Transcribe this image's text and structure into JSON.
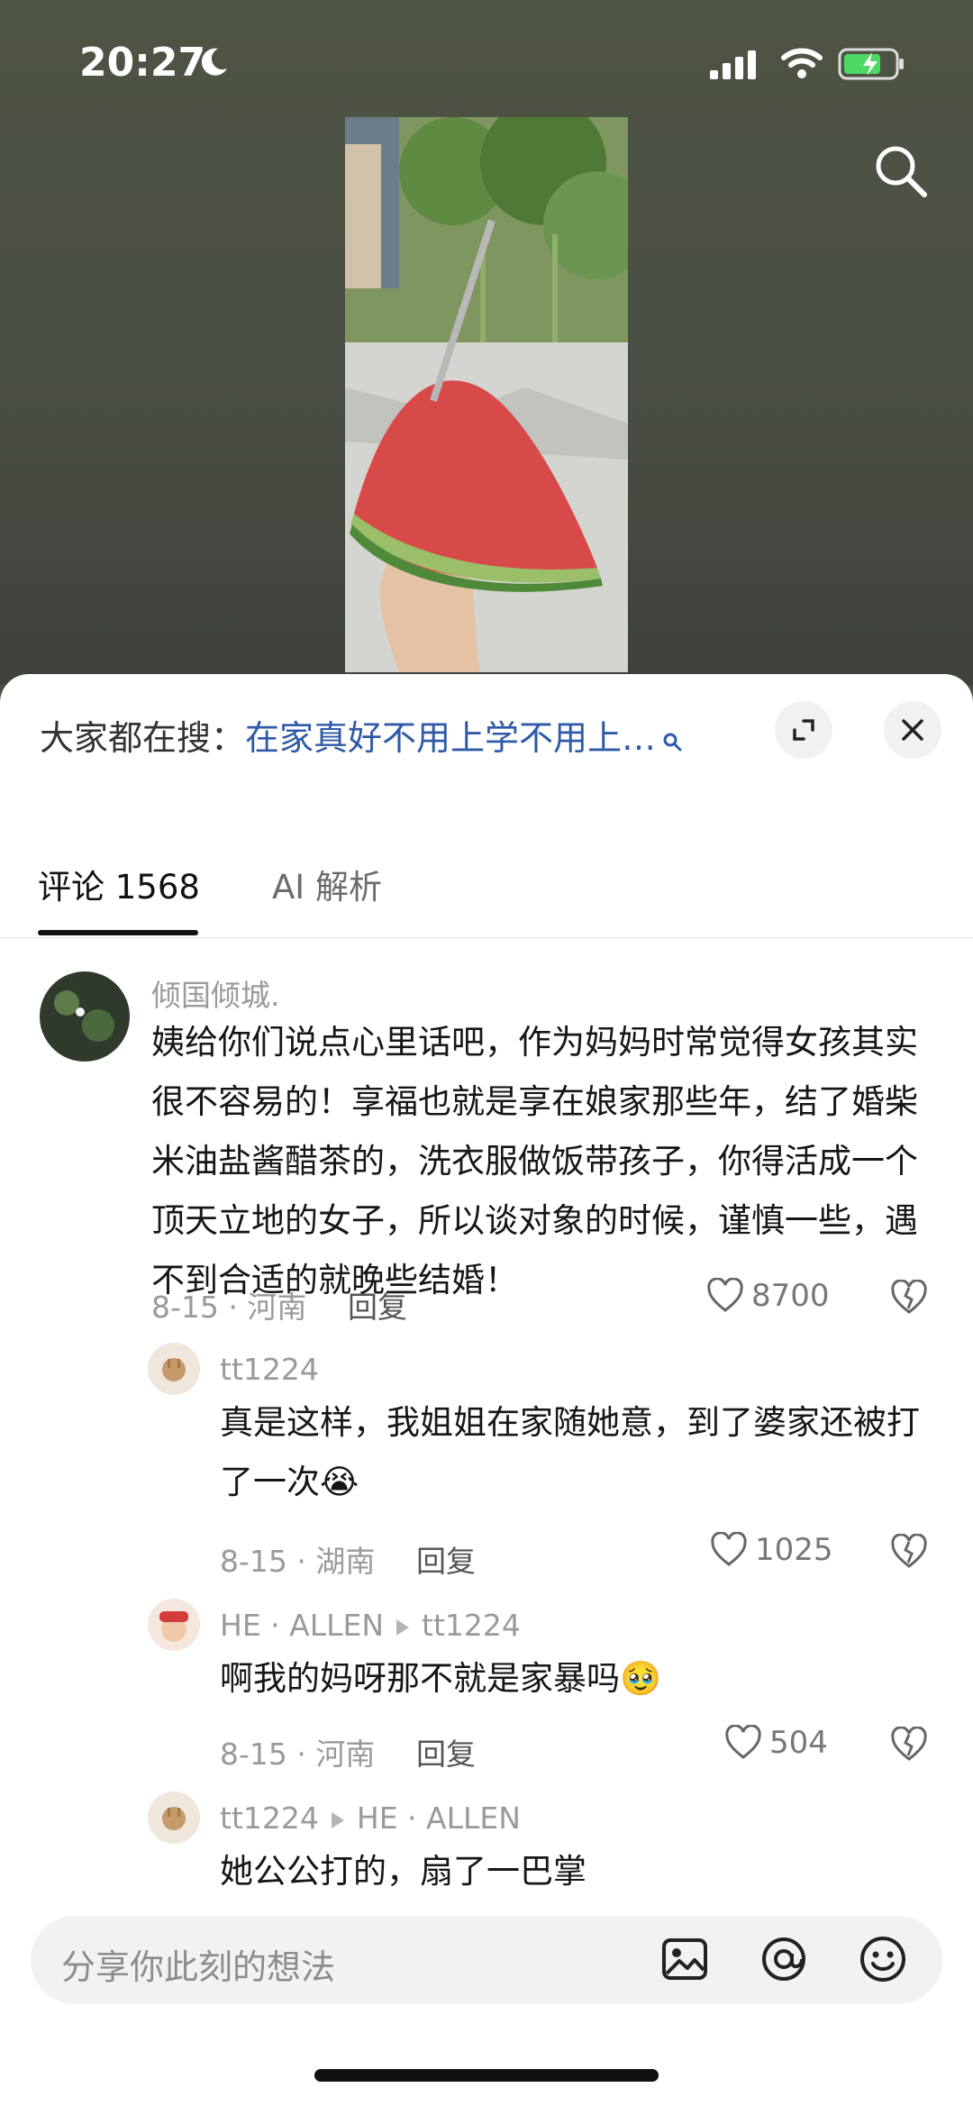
{
  "status_bar": {
    "time": "20:27",
    "icons": [
      "moon-icon",
      "signal-icon",
      "wifi-icon",
      "battery-charging-icon"
    ]
  },
  "top_actions": {
    "search_icon": "search-icon"
  },
  "colors": {
    "sheet_bg": "#ffffff",
    "search_query": "#2f5aa8",
    "accent_text": "#111111",
    "secondary_text": "#9a9a9a"
  },
  "search_suggestion": {
    "prefix": "大家都在搜：",
    "query": "在家真好不用上学不用上…"
  },
  "tabs": [
    {
      "label": "评论 1568",
      "active": true
    },
    {
      "label": "AI 解析",
      "active": false
    }
  ],
  "comments": [
    {
      "author": "倾国倾城.",
      "text": "姨给你们说点心里话吧，作为妈妈时常觉得女孩其实很不容易的！享福也就是享在娘家那些年，结了婚柴米油盐酱醋茶的，洗衣服做饭带孩子，你得活成一个顶天立地的女子，所以谈对象的时候，谨慎一些，遇不到合适的就晚些结婚！",
      "date_location": "8-15 · 河南",
      "reply_label": "回复",
      "likes": "8700"
    },
    {
      "author": "tt1224",
      "text": "真是这样，我姐姐在家随她意，到了婆家还被打了一次😭",
      "date_location": "8-15 · 湖南",
      "reply_label": "回复",
      "likes": "1025"
    },
    {
      "author": "HE · ALLEN",
      "reply_to": "tt1224",
      "text": "啊我的妈呀那不就是家暴吗🥹",
      "date_location": "8-15 · 河南",
      "reply_label": "回复",
      "likes": "504"
    },
    {
      "author": "tt1224",
      "reply_to": "HE · ALLEN",
      "text": "她公公打的，扇了一巴掌"
    }
  ],
  "composer": {
    "placeholder": "分享你此刻的想法",
    "icons": [
      "image-icon",
      "mention-icon",
      "emoji-icon"
    ]
  }
}
